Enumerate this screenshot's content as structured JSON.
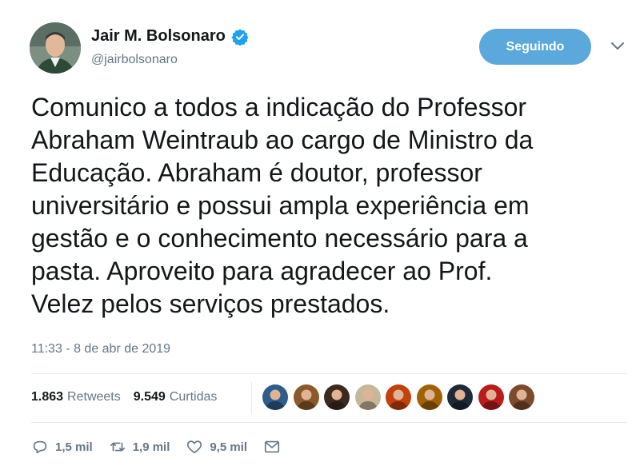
{
  "user": {
    "name": "Jair M. Bolsonaro",
    "handle": "@jairbolsonaro",
    "verified": true
  },
  "follow_button": {
    "label": "Seguindo",
    "color": "#5ba8dd"
  },
  "tweet": {
    "lines": [
      "Comunico a todos a indicação do Professor",
      "Abraham Weintraub ao cargo de Ministro da",
      "Educação. Abraham é doutor, professor",
      "universitário e possui ampla experiência em",
      "gestão e o conhecimento necessário para a",
      "pasta. Aproveito para agradecer ao Prof.",
      "Velez pelos serviços prestados."
    ],
    "timestamp": "11:33 - 8 de abr de 2019"
  },
  "stats": {
    "retweets_count": "1.863",
    "retweets_label": "Retweets",
    "likes_count": "9.549",
    "likes_label": "Curtidas"
  },
  "likers": [
    {
      "color": "#2f5c8a"
    },
    {
      "color": "#8a5a2b"
    },
    {
      "color": "#3d2a1f"
    },
    {
      "color": "#c7b79a"
    },
    {
      "color": "#c2410c"
    },
    {
      "color": "#a16207"
    },
    {
      "color": "#1f2937"
    },
    {
      "color": "#b91c1c"
    },
    {
      "color": "#7c4a2d"
    }
  ],
  "actions": {
    "replies": "1,5 mil",
    "retweets": "1,9 mil",
    "likes": "9,5 mil"
  },
  "colors": {
    "text": "#14171a",
    "muted": "#657786",
    "accent": "#1da1f2"
  }
}
